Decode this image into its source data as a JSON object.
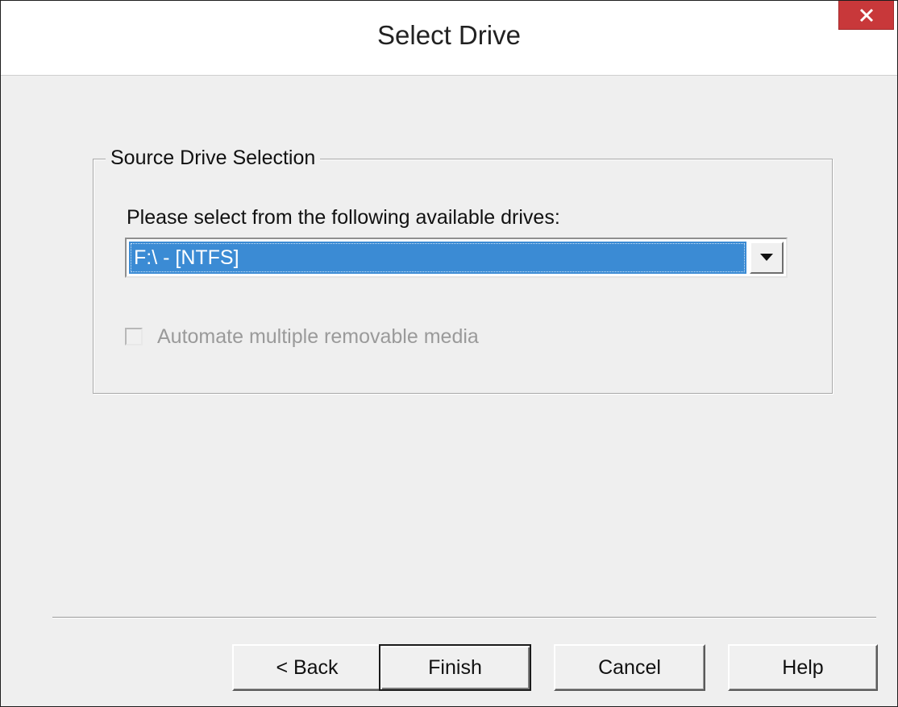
{
  "window": {
    "title": "Select Drive"
  },
  "group": {
    "legend": "Source Drive Selection",
    "prompt": "Please select from the following available drives:",
    "drive_select": {
      "selected": "F:\\ - [NTFS]"
    },
    "automate_checkbox": {
      "label": "Automate multiple removable media",
      "checked": false,
      "enabled": false
    }
  },
  "buttons": {
    "back": "< Back",
    "finish": "Finish",
    "cancel": "Cancel",
    "help": "Help"
  },
  "colors": {
    "selection": "#3b8bd4",
    "close_button": "#c8383a",
    "dialog_background": "#efefef"
  }
}
